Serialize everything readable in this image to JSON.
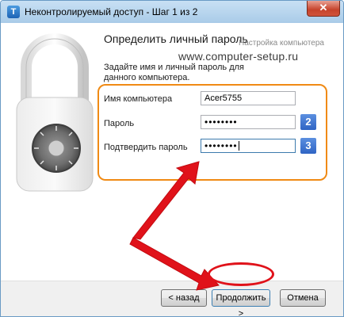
{
  "window": {
    "title": "Неконтролируемый доступ - Шаг 1 из 2",
    "app_icon_glyph": "T",
    "close_glyph": "✕"
  },
  "content": {
    "heading": "Определить личный пароль",
    "overlay_subtitle": "Настройка компьютера",
    "overlay_url": "www.computer-setup.ru",
    "description": "Задайте имя и личный пароль для данного компьютера."
  },
  "form": {
    "computer_name_label": "Имя компьютера",
    "computer_name_value": "Acer5755",
    "password_label": "Пароль",
    "password_value": "••••••••",
    "confirm_label": "Подтвердить пароль",
    "confirm_value": "••••••••",
    "badge_2": "2",
    "badge_3": "3"
  },
  "footer": {
    "back_label": "< назад",
    "next_label": "Продолжить >",
    "cancel_label": "Отмена"
  },
  "colors": {
    "highlight_box": "#f08a14",
    "annotation_red": "#e0121a",
    "badge_blue": "#3a6fd0"
  }
}
